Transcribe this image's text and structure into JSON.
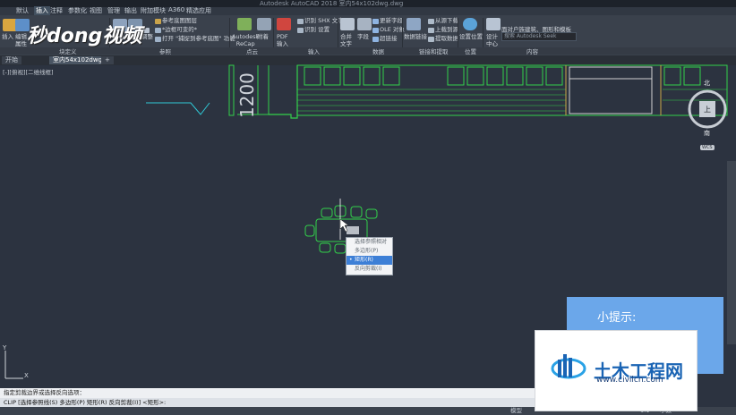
{
  "app": {
    "title": "Autodesk AutoCAD 2018   室内54x102dwg.dwg"
  },
  "menu": {
    "items": [
      "默认",
      "插入",
      "注释",
      "参数化",
      "视图",
      "管理",
      "输出",
      "附加模块",
      "A360",
      "精选应用"
    ],
    "active_index": 1
  },
  "ribbon": {
    "block_def_buttons": {
      "insert": "插入",
      "edit": "编辑",
      "attr": "属性"
    },
    "ref_group": {
      "attach": "附着",
      "clip": "剪裁",
      "adjust": "调整",
      "underlay_layers": "参考底图图层",
      "frames": "*边框可变的*",
      "snap": "打开 \"捕捉到参考底图\" 功能"
    },
    "pointcloud": {
      "recap": "Autodesk\nReCap",
      "attach": "附着"
    },
    "import_group": {
      "pdf": "PDF\n输入",
      "shx": "识别 SHX 文字",
      "settings": "识别 设置"
    },
    "data_group": {
      "combine": "合并\n文字",
      "field": "字段",
      "update_field": "更新字段",
      "ole": "OLE 对象",
      "hyperlink": "超链接",
      "data_link": "数据链接",
      "download_source": "从源下载",
      "upload_source": "上载到源",
      "extract_data": "提取数据",
      "location": "设置位置",
      "design_center": "设计\n中心"
    },
    "groups": [
      "块定义",
      "参照",
      "点云",
      "输入",
      "数据",
      "链接和提取",
      "位置",
      "内容"
    ],
    "search_placeholder": "搜索 Autodesk Seek",
    "content_note": "面对户族建筑、图形和模板"
  },
  "document_tabs": [
    "开始",
    "室内54x102dwg*",
    "+"
  ],
  "viewport": {
    "label": "[-][俯视][二维线框]",
    "dimension_text": "1200",
    "compass_top": "北",
    "compass_center": "上",
    "compass_bottom": "南",
    "wcs": "WCS"
  },
  "context_menu": {
    "items": [
      "选择参照相对",
      "多边形(P)",
      "矩形(R)",
      "反向剪裁(I)"
    ],
    "selected_index": 2
  },
  "command": {
    "history": "指定剪裁边界或选择反向选项：",
    "line": "CLIP [选择参照线(S) 多边形(P) 矩形(R) 反向剪裁(I)] <矩形>:"
  },
  "status": {
    "model": "模型",
    "scale": "1:1",
    "decimal": "小数"
  },
  "tip_box": {
    "title": "小提示:"
  },
  "logo": {
    "name": "土木工程网",
    "url": "www.civilcn.com"
  },
  "watermark": {
    "text": "秒dong视频"
  },
  "colors": {
    "background": "#2c3340",
    "cad_green": "#32d24a",
    "cad_cyan": "#2fc9d6",
    "ribbon": "#3a414c",
    "tip_blue": "#6ba7ea",
    "menu_select": "#3d7fd6"
  }
}
